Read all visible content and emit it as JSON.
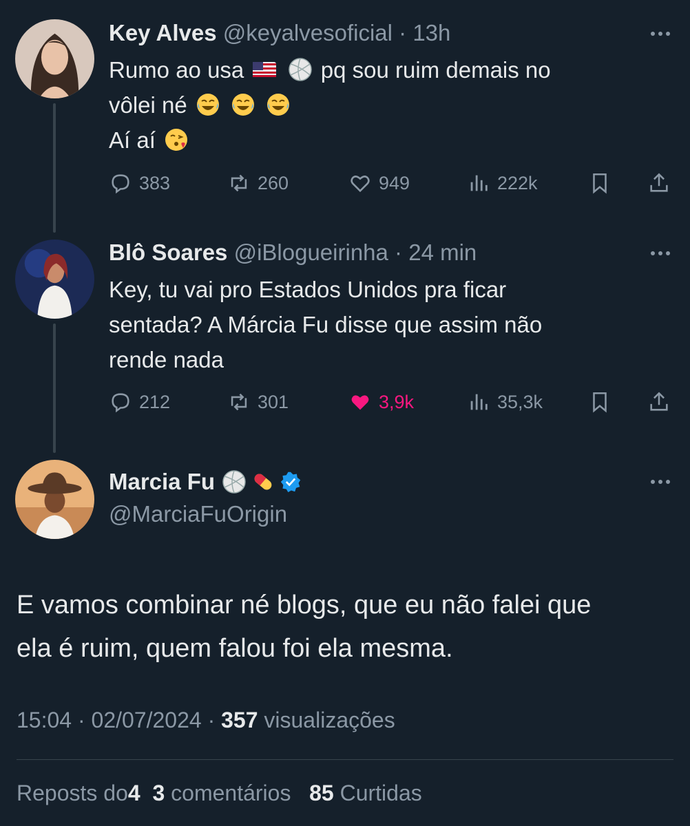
{
  "tweets": [
    {
      "name": "Key Alves",
      "handle": "@keyalvesoficial",
      "time": "13h",
      "text_line1_a": "Rumo ao usa",
      "text_line1_b": "pq sou ruim demais no",
      "text_line2": "vôlei né",
      "text_line3": "Aí aí",
      "replies": "383",
      "reposts": "260",
      "likes": "949",
      "views": "222k"
    },
    {
      "name": "Blô Soares",
      "handle": "@iBlogueirinha",
      "time": "24 min",
      "text_line1": "Key, tu vai pro Estados Unidos pra ficar",
      "text_line2": "sentada? A Márcia Fu  disse que assim não",
      "text_line3": "rende nada",
      "replies": "212",
      "reposts": "301",
      "likes": "3,9k",
      "views": "35,3k"
    }
  ],
  "main": {
    "name": "Marcia Fu",
    "handle": "@MarciaFuOrigin",
    "text_line1": "E vamos combinar né blogs, que eu não falei que",
    "text_line2": "ela é ruim, quem falou foi ela mesma.",
    "time": "15:04",
    "date": "02/07/2024",
    "views_count": "357",
    "views_label": "visualizações",
    "reposts_label": "Reposts do",
    "reposts_count": "4",
    "comments_count": "3",
    "comments_label": "comentários",
    "likes_count": "85",
    "likes_label": "Curtidas"
  },
  "colors": {
    "background": "#15202b",
    "text": "#e7e9ea",
    "muted": "#8b98a5",
    "like": "#f91880",
    "verified": "#1d9bf0"
  },
  "separator": "·"
}
